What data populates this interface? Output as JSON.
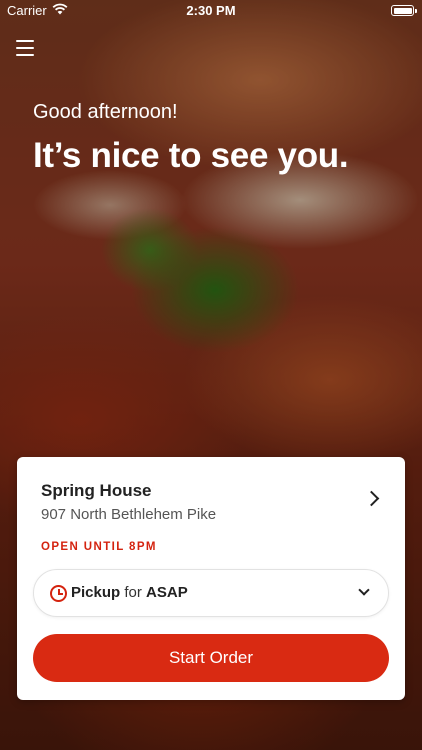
{
  "status_bar": {
    "carrier": "Carrier",
    "time": "2:30 PM"
  },
  "hero": {
    "greeting": "Good afternoon!",
    "headline": "It’s nice to see you."
  },
  "location": {
    "name": "Spring House",
    "address": "907 North Bethlehem Pike",
    "hours_status": "OPEN UNTIL 8PM"
  },
  "order_type": {
    "mode": "Pickup",
    "connector": "for",
    "time": "ASAP"
  },
  "actions": {
    "start_order_label": "Start Order"
  },
  "colors": {
    "accent": "#d92a12",
    "status_open": "#d4230f"
  },
  "icons": {
    "menu": "hamburger-menu-icon",
    "wifi": "wifi-icon",
    "battery": "battery-icon",
    "location_chevron": "chevron-right-icon",
    "clock": "clock-icon",
    "dropdown": "chevron-down-icon"
  }
}
